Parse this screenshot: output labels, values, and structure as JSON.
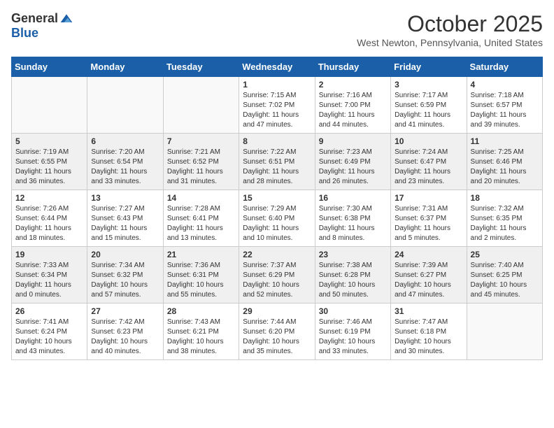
{
  "logo": {
    "general": "General",
    "blue": "Blue"
  },
  "title": "October 2025",
  "location": "West Newton, Pennsylvania, United States",
  "days_header": [
    "Sunday",
    "Monday",
    "Tuesday",
    "Wednesday",
    "Thursday",
    "Friday",
    "Saturday"
  ],
  "weeks": [
    [
      {
        "day": "",
        "info": ""
      },
      {
        "day": "",
        "info": ""
      },
      {
        "day": "",
        "info": ""
      },
      {
        "day": "1",
        "info": "Sunrise: 7:15 AM\nSunset: 7:02 PM\nDaylight: 11 hours and 47 minutes."
      },
      {
        "day": "2",
        "info": "Sunrise: 7:16 AM\nSunset: 7:00 PM\nDaylight: 11 hours and 44 minutes."
      },
      {
        "day": "3",
        "info": "Sunrise: 7:17 AM\nSunset: 6:59 PM\nDaylight: 11 hours and 41 minutes."
      },
      {
        "day": "4",
        "info": "Sunrise: 7:18 AM\nSunset: 6:57 PM\nDaylight: 11 hours and 39 minutes."
      }
    ],
    [
      {
        "day": "5",
        "info": "Sunrise: 7:19 AM\nSunset: 6:55 PM\nDaylight: 11 hours and 36 minutes."
      },
      {
        "day": "6",
        "info": "Sunrise: 7:20 AM\nSunset: 6:54 PM\nDaylight: 11 hours and 33 minutes."
      },
      {
        "day": "7",
        "info": "Sunrise: 7:21 AM\nSunset: 6:52 PM\nDaylight: 11 hours and 31 minutes."
      },
      {
        "day": "8",
        "info": "Sunrise: 7:22 AM\nSunset: 6:51 PM\nDaylight: 11 hours and 28 minutes."
      },
      {
        "day": "9",
        "info": "Sunrise: 7:23 AM\nSunset: 6:49 PM\nDaylight: 11 hours and 26 minutes."
      },
      {
        "day": "10",
        "info": "Sunrise: 7:24 AM\nSunset: 6:47 PM\nDaylight: 11 hours and 23 minutes."
      },
      {
        "day": "11",
        "info": "Sunrise: 7:25 AM\nSunset: 6:46 PM\nDaylight: 11 hours and 20 minutes."
      }
    ],
    [
      {
        "day": "12",
        "info": "Sunrise: 7:26 AM\nSunset: 6:44 PM\nDaylight: 11 hours and 18 minutes."
      },
      {
        "day": "13",
        "info": "Sunrise: 7:27 AM\nSunset: 6:43 PM\nDaylight: 11 hours and 15 minutes."
      },
      {
        "day": "14",
        "info": "Sunrise: 7:28 AM\nSunset: 6:41 PM\nDaylight: 11 hours and 13 minutes."
      },
      {
        "day": "15",
        "info": "Sunrise: 7:29 AM\nSunset: 6:40 PM\nDaylight: 11 hours and 10 minutes."
      },
      {
        "day": "16",
        "info": "Sunrise: 7:30 AM\nSunset: 6:38 PM\nDaylight: 11 hours and 8 minutes."
      },
      {
        "day": "17",
        "info": "Sunrise: 7:31 AM\nSunset: 6:37 PM\nDaylight: 11 hours and 5 minutes."
      },
      {
        "day": "18",
        "info": "Sunrise: 7:32 AM\nSunset: 6:35 PM\nDaylight: 11 hours and 2 minutes."
      }
    ],
    [
      {
        "day": "19",
        "info": "Sunrise: 7:33 AM\nSunset: 6:34 PM\nDaylight: 11 hours and 0 minutes."
      },
      {
        "day": "20",
        "info": "Sunrise: 7:34 AM\nSunset: 6:32 PM\nDaylight: 10 hours and 57 minutes."
      },
      {
        "day": "21",
        "info": "Sunrise: 7:36 AM\nSunset: 6:31 PM\nDaylight: 10 hours and 55 minutes."
      },
      {
        "day": "22",
        "info": "Sunrise: 7:37 AM\nSunset: 6:29 PM\nDaylight: 10 hours and 52 minutes."
      },
      {
        "day": "23",
        "info": "Sunrise: 7:38 AM\nSunset: 6:28 PM\nDaylight: 10 hours and 50 minutes."
      },
      {
        "day": "24",
        "info": "Sunrise: 7:39 AM\nSunset: 6:27 PM\nDaylight: 10 hours and 47 minutes."
      },
      {
        "day": "25",
        "info": "Sunrise: 7:40 AM\nSunset: 6:25 PM\nDaylight: 10 hours and 45 minutes."
      }
    ],
    [
      {
        "day": "26",
        "info": "Sunrise: 7:41 AM\nSunset: 6:24 PM\nDaylight: 10 hours and 43 minutes."
      },
      {
        "day": "27",
        "info": "Sunrise: 7:42 AM\nSunset: 6:23 PM\nDaylight: 10 hours and 40 minutes."
      },
      {
        "day": "28",
        "info": "Sunrise: 7:43 AM\nSunset: 6:21 PM\nDaylight: 10 hours and 38 minutes."
      },
      {
        "day": "29",
        "info": "Sunrise: 7:44 AM\nSunset: 6:20 PM\nDaylight: 10 hours and 35 minutes."
      },
      {
        "day": "30",
        "info": "Sunrise: 7:46 AM\nSunset: 6:19 PM\nDaylight: 10 hours and 33 minutes."
      },
      {
        "day": "31",
        "info": "Sunrise: 7:47 AM\nSunset: 6:18 PM\nDaylight: 10 hours and 30 minutes."
      },
      {
        "day": "",
        "info": ""
      }
    ]
  ]
}
